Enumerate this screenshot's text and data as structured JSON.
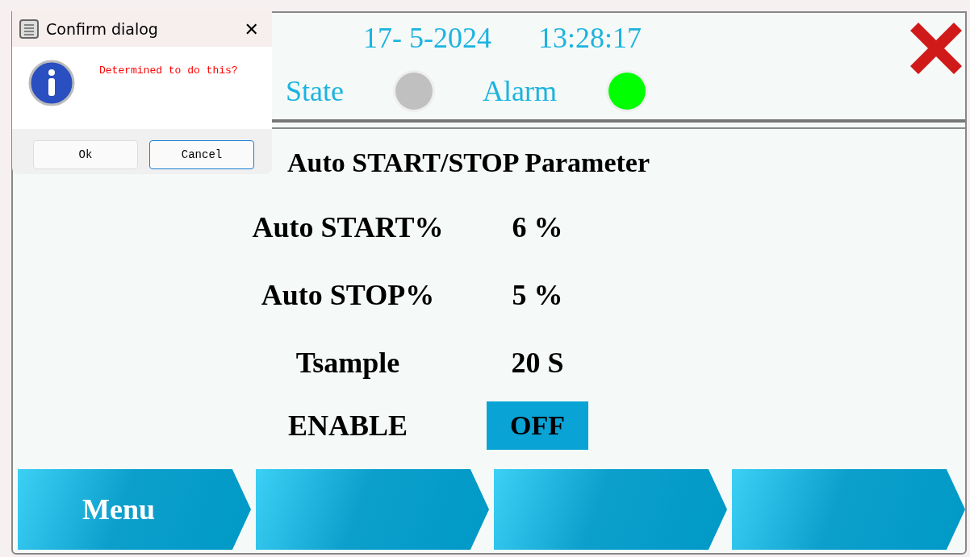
{
  "header": {
    "date": "17- 5-2024",
    "time": "13:28:17",
    "indicators": [
      {
        "label": "State",
        "color": "#c0c0c0"
      },
      {
        "label": "Alarm",
        "color": "#00ff00"
      }
    ]
  },
  "title": "Auto START/STOP Parameter",
  "parameters": [
    {
      "kind": "value",
      "label": "Auto START%",
      "value": "6 %"
    },
    {
      "kind": "value",
      "label": "Auto STOP%",
      "value": "5 %"
    },
    {
      "kind": "value",
      "label": "Tsample",
      "value": "20 S"
    },
    {
      "kind": "toggle",
      "label": "ENABLE",
      "value": "OFF"
    }
  ],
  "nav_buttons": [
    {
      "kind": "labeled",
      "label": "Menu"
    },
    {
      "kind": "blank"
    },
    {
      "kind": "blank"
    },
    {
      "kind": "blank"
    }
  ],
  "dialog": {
    "title": "Confirm dialog",
    "close": "✕",
    "message": "Determined to do this?",
    "buttons": [
      {
        "label": "Ok",
        "selected": false
      },
      {
        "label": "Cancel",
        "selected": true
      }
    ]
  }
}
